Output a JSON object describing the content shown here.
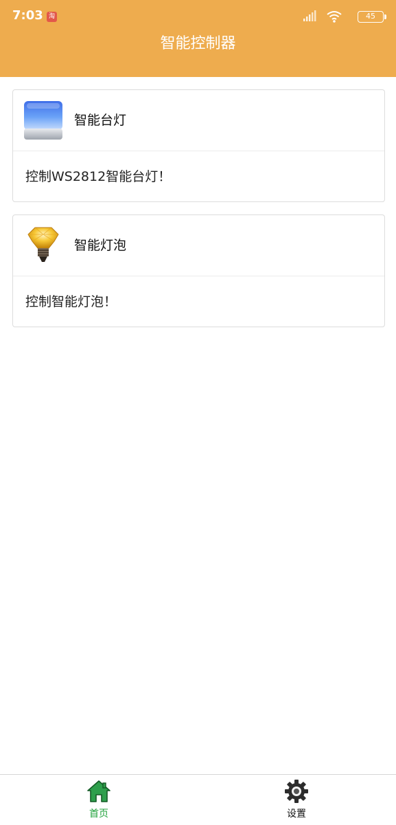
{
  "status_bar": {
    "time": "7:03",
    "app_badge": "淘",
    "battery": "45",
    "icons": [
      "signal-icon",
      "wifi-icon",
      "battery-icon"
    ]
  },
  "header": {
    "title": "智能控制器",
    "background_color": "#EEAC4E"
  },
  "cards": [
    {
      "title": "智能台灯",
      "description": "控制WS2812智能台灯！",
      "icon": "desk-lamp-icon"
    },
    {
      "title": "智能灯泡",
      "description": "控制智能灯泡！",
      "icon": "light-bulb-icon"
    }
  ],
  "bottom_nav": {
    "items": [
      {
        "label": "首页",
        "icon": "home-icon",
        "active": true,
        "color": "#1fa13a"
      },
      {
        "label": "设置",
        "icon": "gear-icon",
        "active": false,
        "color": "#111111"
      }
    ]
  }
}
